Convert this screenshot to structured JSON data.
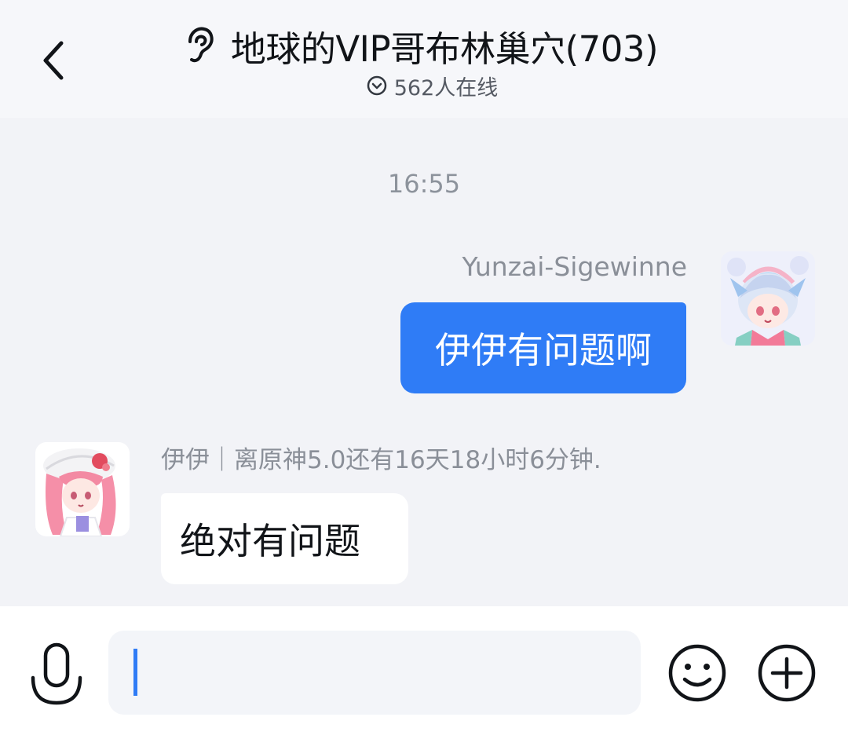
{
  "header": {
    "title": "地球的VIP哥布林巢穴(703)",
    "online_text": "562人在线"
  },
  "messages": {
    "timestamp": "16:55",
    "outgoing": {
      "sender": "Yunzai-Sigewinne",
      "text": "伊伊有问题啊"
    },
    "incoming": {
      "sender": "伊伊｜离原神5.0还有16天18小时6分钟.",
      "text": "绝对有问题"
    }
  },
  "input_bar": {
    "placeholder": ""
  },
  "icons": {
    "back": "chevron-left-icon",
    "ear": "ear-icon",
    "online": "chevron-down-circle-icon",
    "voice": "microphone-icon",
    "emoji": "smiley-icon",
    "plus": "plus-circle-icon"
  },
  "colors": {
    "accent": "#2f7cf6",
    "background": "#f2f3f7",
    "header_bg": "#f6f7fa",
    "secondary_text": "#8a8f98"
  }
}
